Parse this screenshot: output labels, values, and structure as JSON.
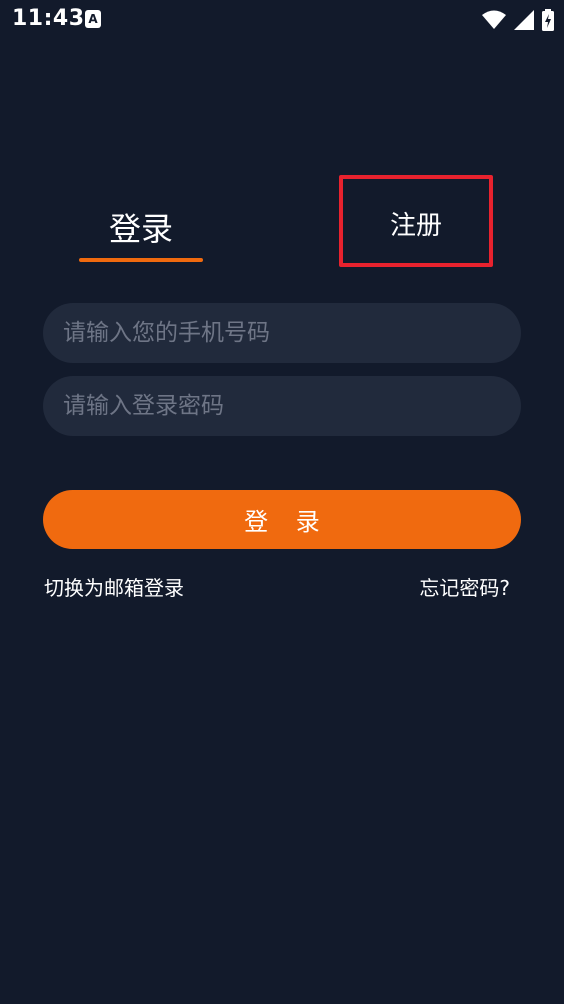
{
  "status_bar": {
    "time": "11:43",
    "app_icon_letter": "A",
    "icons": [
      "wifi-icon",
      "signal-icon",
      "battery-charging-icon"
    ]
  },
  "tabs": {
    "login_label": "登录",
    "register_label": "注册"
  },
  "form": {
    "phone_placeholder": "请输入您的手机号码",
    "phone_value": "",
    "password_placeholder": "请输入登录密码",
    "password_value": ""
  },
  "actions": {
    "login_button_label": "登 录",
    "switch_email_label": "切换为邮箱登录",
    "forgot_password_label": "忘记密码?"
  },
  "colors": {
    "background": "#121a2b",
    "field_background": "#212a3c",
    "accent": "#f06a0f",
    "highlight_box": "#e8222e"
  }
}
